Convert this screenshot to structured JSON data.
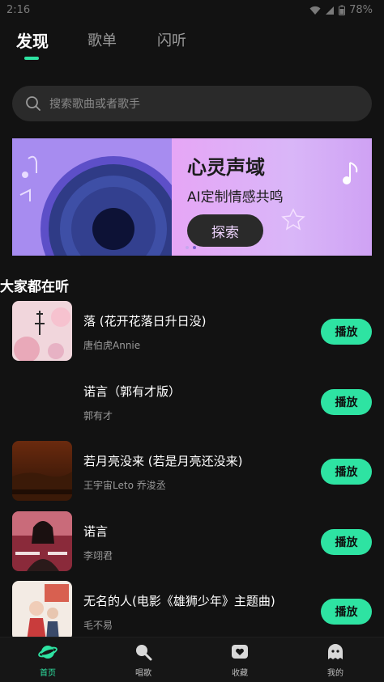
{
  "status_bar": {
    "time": "2:16",
    "battery": "78%"
  },
  "tabs": [
    {
      "label": "发现",
      "active": true
    },
    {
      "label": "歌单",
      "active": false
    },
    {
      "label": "闪听",
      "active": false
    }
  ],
  "search": {
    "placeholder": "搜索歌曲或者歌手",
    "icon": "search-icon"
  },
  "banner": {
    "title": "心灵声域",
    "subtitle": "AI定制情感共鸣",
    "button_label": "探索"
  },
  "section": {
    "title": "大家都在听"
  },
  "songs": [
    {
      "title": "落 (花开花落日升日没)",
      "artist": "唐伯虎Annie",
      "play_label": "播放"
    },
    {
      "title": "诺言（郭有才版）",
      "artist": "郭有才",
      "play_label": "播放"
    },
    {
      "title": "若月亮没来 (若是月亮还没来)",
      "artist": "王宇宙Leto 乔浚丞",
      "play_label": "播放"
    },
    {
      "title": "诺言",
      "artist": "李翊君",
      "play_label": "播放"
    },
    {
      "title": "无名的人(电影《雄狮少年》主题曲)",
      "artist": "毛不易",
      "play_label": "播放"
    }
  ],
  "bottom_nav": [
    {
      "label": "首页",
      "icon": "planet-icon",
      "active": true
    },
    {
      "label": "唱歌",
      "icon": "microphone-icon",
      "active": false
    },
    {
      "label": "收藏",
      "icon": "heart-icon",
      "active": false
    },
    {
      "label": "我的",
      "icon": "ghost-icon",
      "active": false
    }
  ],
  "colors": {
    "accent": "#2ee3a2",
    "background": "#121212",
    "search_bg": "#2a2a2a"
  }
}
